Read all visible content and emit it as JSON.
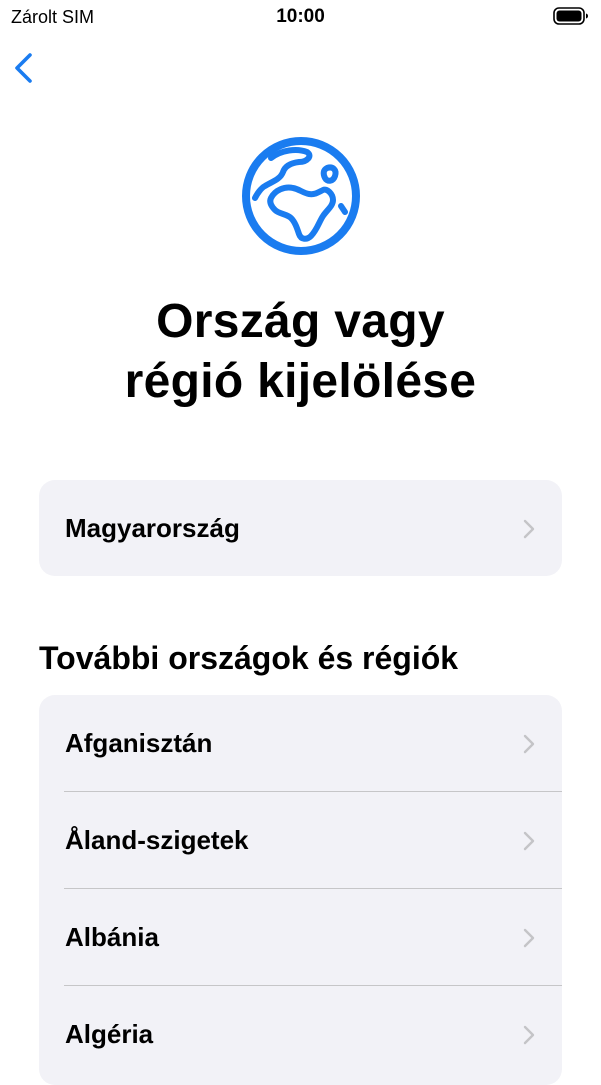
{
  "status_bar": {
    "carrier": "Zárolt SIM",
    "time": "10:00",
    "battery_icon": "battery-full-icon"
  },
  "nav": {
    "back_icon": "chevron-left-icon"
  },
  "hero": {
    "icon": "globe-icon",
    "title_line1": "Ország vagy",
    "title_line2": "régió kijelölése"
  },
  "current": {
    "label": "Magyarország"
  },
  "section": {
    "title": "További országok és régiók"
  },
  "countries": [
    {
      "label": "Afganisztán"
    },
    {
      "label": "Åland-szigetek"
    },
    {
      "label": "Albánia"
    },
    {
      "label": "Algéria"
    }
  ],
  "colors": {
    "accent": "#1a7cf0",
    "card_bg": "#f2f2f7",
    "chevron": "#c4c4c7",
    "divider": "#c6c6c8"
  }
}
